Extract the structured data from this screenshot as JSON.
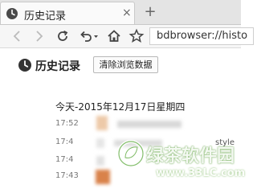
{
  "tab": {
    "title": "历史记录",
    "close_glyph": "×",
    "icon": "clock-icon"
  },
  "new_tab": {
    "glyph": "+"
  },
  "toolbar": {
    "back_icon": "back-arrow-icon",
    "forward_icon": "forward-arrow-icon",
    "reload_icon": "reload-icon",
    "undo_icon": "undo-icon",
    "home_icon": "home-icon",
    "favorite_icon": "star-icon",
    "address_value": "bdbrowser://histo"
  },
  "page": {
    "title": "历史记录",
    "clear_button_label": "清除浏览数据",
    "date_heading": "今天-2015年12月17日星期四"
  },
  "history": [
    {
      "time": "17:52",
      "snippet": ""
    },
    {
      "time": "17:4",
      "snippet": ""
    },
    {
      "time": "17:4",
      "snippet": "style"
    },
    {
      "time": "17:43",
      "snippet": ""
    }
  ],
  "watermark": {
    "name": "绿茶软件园",
    "url": "www.33LC.com"
  },
  "colors": {
    "tabstrip": "#e4e4e4",
    "toolbar": "#f6f6f6",
    "watermark_green": "#5aa83a",
    "blur_orange": "#e8a06a"
  }
}
